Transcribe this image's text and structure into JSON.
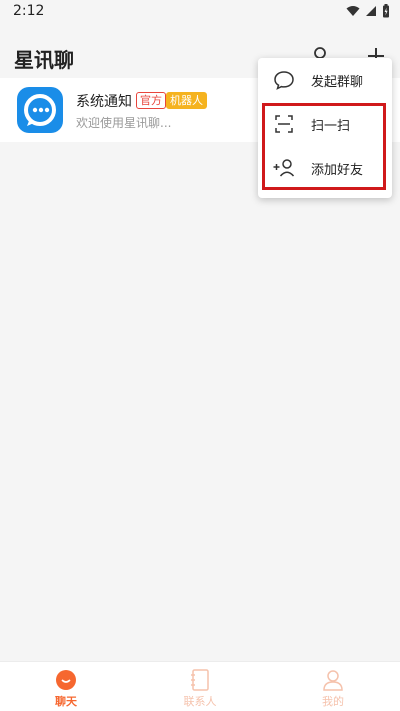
{
  "status_bar": {
    "time": "2:12",
    "icons": [
      "wifi-icon",
      "signal-icon",
      "battery-charging-icon"
    ]
  },
  "header": {
    "title": "星讯聊",
    "icons": [
      "search-icon",
      "plus-icon"
    ]
  },
  "conversations": [
    {
      "name": "系统通知",
      "badges": [
        "官方",
        "机器人"
      ],
      "preview": "欢迎使用星讯聊...",
      "avatar_icon": "chat-bubble-icon"
    }
  ],
  "popup_menu": {
    "items": [
      {
        "icon": "chat-bubble-icon",
        "label": "发起群聊"
      },
      {
        "icon": "scan-icon",
        "label": "扫一扫"
      },
      {
        "icon": "add-friend-icon",
        "label": "添加好友"
      }
    ],
    "highlighted": [
      "扫一扫",
      "添加好友"
    ]
  },
  "bottom_nav": {
    "tabs": [
      {
        "label": "聊天",
        "icon": "chat-icon",
        "active": true
      },
      {
        "label": "联系人",
        "icon": "contacts-book-icon",
        "active": false
      },
      {
        "label": "我的",
        "icon": "profile-icon",
        "active": false
      }
    ]
  },
  "colors": {
    "accent": "#f6672f",
    "avatar_blue": "#1a8de8",
    "badge_official": "#e8453c",
    "badge_robot": "#f5b31f",
    "highlight": "#d0191b"
  }
}
